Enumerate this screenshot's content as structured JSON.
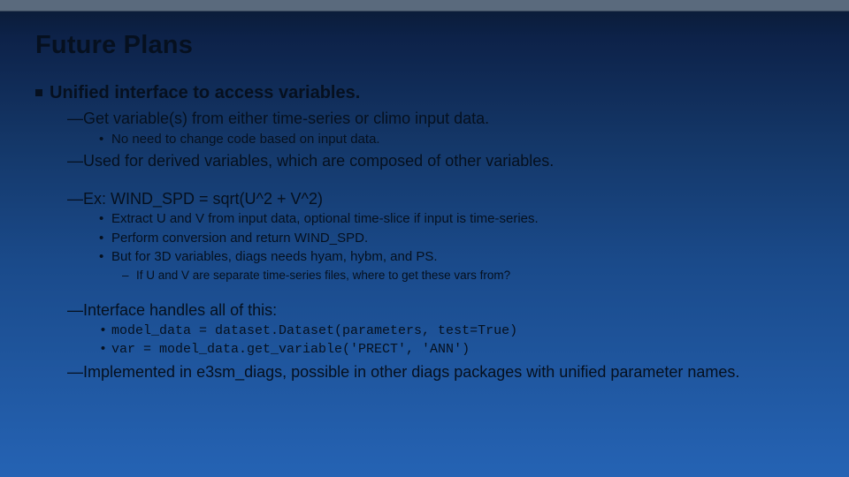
{
  "title": "Future Plans",
  "main": {
    "heading": "Unified interface to access variables.",
    "d1": "Get variable(s) from either time-series or climo input data.",
    "d1a": "No need to change code based on input data.",
    "d2": "Used for derived variables, which are composed of other variables.",
    "d3": "Ex: WIND_SPD = sqrt(U^2 + V^2)",
    "d3a": "Extract U and V from input data, optional time-slice if input is time-series.",
    "d3b": "Perform conversion and return WIND_SPD.",
    "d3c": "But for 3D variables, diags needs hyam, hybm, and PS.",
    "d3c1": "If U and V are separate time-series files, where to get these vars from?",
    "d4": "Interface handles all of this:",
    "d4a": "model_data = dataset.Dataset(parameters, test=True)",
    "d4b": "var = model_data.get_variable('PRECT', 'ANN')",
    "d5": "Implemented in e3sm_diags, possible in other diags packages with unified parameter names."
  }
}
